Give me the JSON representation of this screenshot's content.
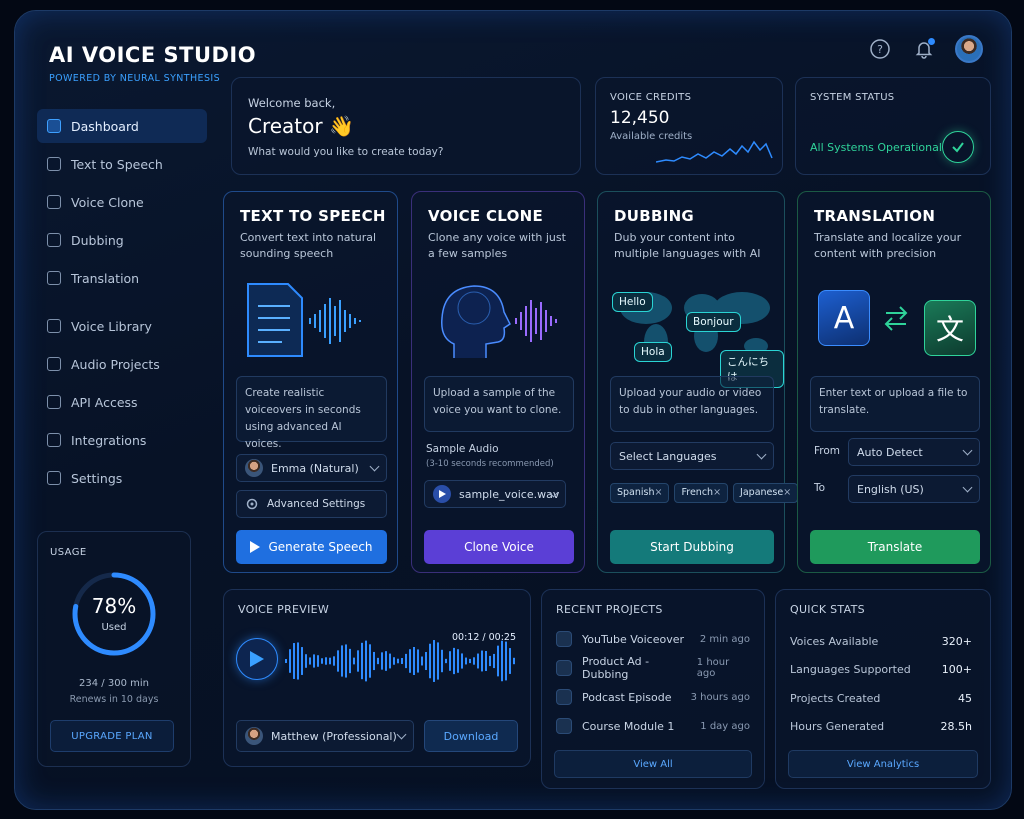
{
  "app": {
    "title": "AI VOICE STUDIO",
    "subtitle": "POWERED BY NEURAL SYNTHESIS"
  },
  "header": {
    "icons": [
      "help-icon",
      "bell-icon",
      "user-avatar"
    ],
    "accent": "#2e8bff"
  },
  "sidebar": {
    "items": [
      {
        "label": "Dashboard",
        "icon": "dashboard-icon",
        "active": true
      },
      {
        "label": "Text to Speech",
        "icon": "document-icon"
      },
      {
        "label": "Voice Clone",
        "icon": "clone-icon"
      },
      {
        "label": "Dubbing",
        "icon": "dubbing-icon"
      },
      {
        "label": "Translation",
        "icon": "globe-icon"
      },
      {
        "label": "Voice Library",
        "icon": "library-icon"
      },
      {
        "label": "Audio Projects",
        "icon": "folder-icon"
      },
      {
        "label": "API Access",
        "icon": "api-icon"
      },
      {
        "label": "Integrations",
        "icon": "integrations-icon"
      },
      {
        "label": "Settings",
        "icon": "gear-icon"
      }
    ]
  },
  "usage": {
    "title": "USAGE",
    "percent": "78%",
    "percent_value": 0.78,
    "used_label": "Used",
    "minutes": "234 / 300 min",
    "renews": "Renews in 10 days",
    "upgrade": "UPGRADE PLAN"
  },
  "welcome": {
    "greeting": "Welcome back,",
    "name": "Creator 👋",
    "prompt": "What would you like to create today?"
  },
  "credits": {
    "title": "VOICE CREDITS",
    "value": "12,450",
    "caption": "Available credits"
  },
  "system": {
    "title": "SYSTEM STATUS",
    "status": "All Systems Operational",
    "status_color": "#2fd39a"
  },
  "tts": {
    "title": "TEXT TO SPEECH",
    "desc": "Convert text into natural sounding speech",
    "info": "Create realistic voiceovers in seconds using advanced AI voices.",
    "voice": "Emma (Natural)",
    "advanced": "Advanced Settings",
    "button": "Generate Speech",
    "color": "#1f6fe0"
  },
  "clone": {
    "title": "VOICE CLONE",
    "desc": "Clone any voice with just a few samples",
    "info": "Upload a sample of the voice you want to clone.",
    "sample_label": "Sample Audio",
    "sample_hint": "(3-10 seconds recommended)",
    "file": "sample_voice.wav",
    "button": "Clone Voice",
    "color": "#5b3fd6"
  },
  "dubbing": {
    "title": "DUBBING",
    "desc": "Dub your content into multiple languages with AI",
    "bubbles": [
      "Hello",
      "Bonjour",
      "Hola",
      "こんにちは"
    ],
    "info": "Upload your audio or video to dub in other languages.",
    "select": "Select Languages",
    "chips": [
      "Spanish",
      "French",
      "Japanese"
    ],
    "button": "Start Dubbing",
    "color": "#147a7a"
  },
  "translation": {
    "title": "TRANSLATION",
    "desc": "Translate and localize your content with precision",
    "glyph_from": "A",
    "glyph_to": "文",
    "info": "Enter text or upload a file to translate.",
    "from_label": "From",
    "from_value": "Auto Detect",
    "to_label": "To",
    "to_value": "English (US)",
    "button": "Translate",
    "color": "#1f9a5c"
  },
  "preview": {
    "title": "VOICE PREVIEW",
    "time": "00:12 / 00:25",
    "voice": "Matthew (Professional)",
    "download": "Download"
  },
  "projects": {
    "title": "RECENT PROJECTS",
    "items": [
      {
        "name": "YouTube Voiceover",
        "time": "2 min ago"
      },
      {
        "name": "Product Ad - Dubbing",
        "time": "1 hour ago"
      },
      {
        "name": "Podcast Episode",
        "time": "3 hours ago"
      },
      {
        "name": "Course Module 1",
        "time": "1 day ago"
      }
    ],
    "view_all": "View All"
  },
  "stats": {
    "title": "QUICK STATS",
    "items": [
      {
        "label": "Voices Available",
        "value": "320+"
      },
      {
        "label": "Languages Supported",
        "value": "100+"
      },
      {
        "label": "Projects Created",
        "value": "45"
      },
      {
        "label": "Hours Generated",
        "value": "28.5h"
      }
    ],
    "view": "View Analytics"
  }
}
